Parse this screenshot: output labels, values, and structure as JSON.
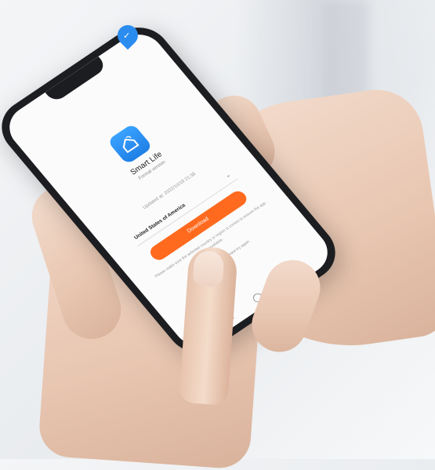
{
  "app": {
    "name": "Smart Life",
    "version": "Formal version",
    "updated": "Updated at: 2022/10/18 21:38"
  },
  "download": {
    "country": "United States of America",
    "button_label": "Download",
    "note": "Please make sure the selected country or region is correct to ensure the app is available.",
    "fallback": "If download fails, please try again"
  },
  "status": {
    "time": "",
    "icons": ""
  },
  "colors": {
    "accent": "#ff6a1e",
    "app_icon": "#2b8cf0"
  }
}
